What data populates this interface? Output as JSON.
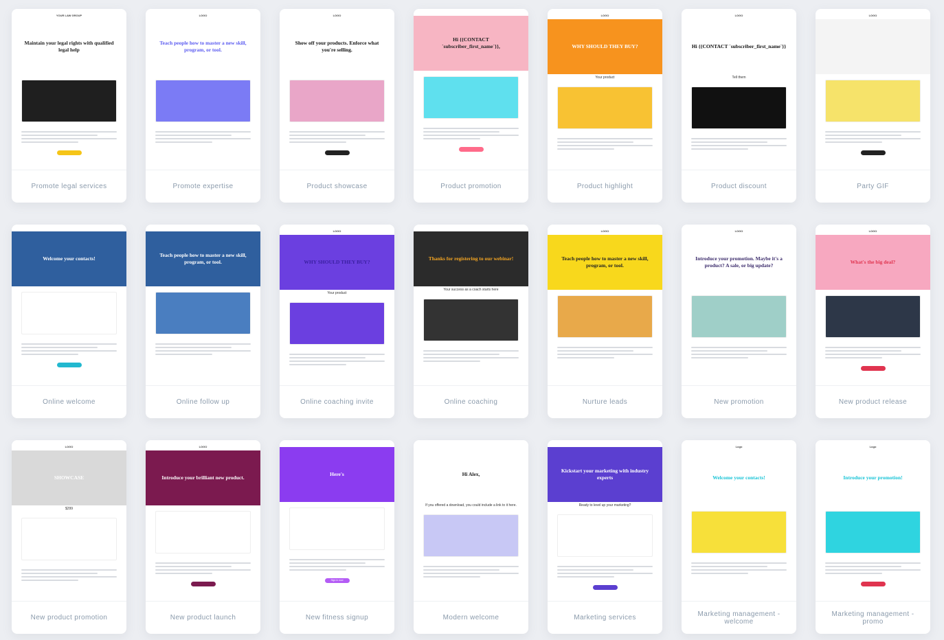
{
  "templates": [
    {
      "label": "Promote legal services",
      "logo": "YOUR LAW GROUP",
      "headline": "Maintain your legal rights with qualified legal help",
      "hero": "#ffffff",
      "text": "#222222",
      "img": "#1f1f1f",
      "btn": "#f5c518"
    },
    {
      "label": "Promote expertise",
      "logo": "LOGO",
      "headline": "Teach people how to master a new skill, program, or tool.",
      "hero": "#ffffff",
      "text": "#5b5bf0",
      "img": "#7b7bf5"
    },
    {
      "label": "Product showcase",
      "logo": "LOGO",
      "headline": "Show off your products. Enforce what you're selling.",
      "hero": "#ffffff",
      "text": "#111111",
      "img": "#e9a6c8",
      "btn": "#222222"
    },
    {
      "label": "Product promotion",
      "logo": "",
      "headline": "Hi {{CONTACT `subscriber_first_name`}},",
      "hero": "#f7b5c3",
      "text": "#222222",
      "img": "#5fe0ee",
      "btn": "#ff6b8a"
    },
    {
      "label": "Product highlight",
      "logo": "LOGO",
      "headline": "WHY SHOULD THEY BUY?",
      "hero": "#f7931e",
      "text": "#ffffff",
      "img": "#f8c233",
      "sub": "Your product"
    },
    {
      "label": "Product discount",
      "logo": "LOGO",
      "headline": "Hi {{CONTACT `subscriber_first_name`}}",
      "hero": "#ffffff",
      "text": "#111111",
      "img": "#111111",
      "sub": "Tell them"
    },
    {
      "label": "Party GIF",
      "logo": "LOGO",
      "headline": "",
      "hero": "#f4f4f4",
      "text": "#222222",
      "img": "#f6e36a",
      "btn": "#222222"
    },
    {
      "label": "Online welcome",
      "logo": "",
      "headline": "Welcome your contacts!",
      "hero": "#2f5f9e",
      "text": "#ffffff",
      "img": "#ffffff",
      "btn": "#22b8cf"
    },
    {
      "label": "Online follow up",
      "logo": "",
      "headline": "Teach people how to master a new skill, program, or tool.",
      "hero": "#2f5f9e",
      "text": "#ffffff",
      "img": "#4a7ec0"
    },
    {
      "label": "Online coaching invite",
      "logo": "LOGO",
      "headline": "WHY SHOULD THEY BUY?",
      "hero": "#6b3fe0",
      "text": "#3a1fa0",
      "img": "#6b3fe0",
      "sub": "Your product"
    },
    {
      "label": "Online coaching",
      "logo": "",
      "headline": "Thanks for registering to our webinar!",
      "hero": "#2b2b2b",
      "text": "#f5a623",
      "img": "#333333",
      "sub": "Your success as a coach starts here"
    },
    {
      "label": "Nurture leads",
      "logo": "LOGO",
      "headline": "Teach people how to master a new skill, program, or tool.",
      "hero": "#f8d81c",
      "text": "#222222",
      "img": "#e8a94a"
    },
    {
      "label": "New promotion",
      "logo": "LOGO",
      "headline": "Introduce your promotion. Maybe it's a product? A sale, or big update?",
      "hero": "#ffffff",
      "text": "#3a2a6a",
      "img": "#9fcfc8"
    },
    {
      "label": "New product release",
      "logo": "LOGO",
      "headline": "What's the big deal?",
      "hero": "#f7a8c0",
      "text": "#e0344f",
      "img": "#2d3748",
      "btn": "#e0344f"
    },
    {
      "label": "New product promotion",
      "logo": "LOGO",
      "headline": "SHOWCASE",
      "hero": "#d9d9d9",
      "text": "#ffffff",
      "img": "#ffffff",
      "sub": "$299"
    },
    {
      "label": "New product launch",
      "logo": "LOGO",
      "headline": "Introduce your brilliant new product.",
      "hero": "#7b1a4f",
      "text": "#ffffff",
      "img": "#ffffff",
      "btn": "#7b1a4f"
    },
    {
      "label": "New fitness signup",
      "logo": "",
      "headline": "Here's",
      "hero": "#8b3cf0",
      "text": "#ffffff",
      "img": "#ffffff",
      "btn": "#b45cf5",
      "button": "Sign in now"
    },
    {
      "label": "Modern welcome",
      "logo": "",
      "headline": "Hi Alex,",
      "hero": "#ffffff",
      "text": "#222222",
      "img": "#c8c8f5",
      "sub": "If you offered a download, you could include a link to it here."
    },
    {
      "label": "Marketing services",
      "logo": "",
      "headline": "Kickstart your marketing with industry experts",
      "hero": "#5b3fd0",
      "text": "#ffffff",
      "img": "#ffffff",
      "sub": "Ready to level up your marketing?",
      "btn": "#5b3fd0"
    },
    {
      "label": "Marketing management - welcome",
      "logo": "Logo",
      "headline": "Welcome your contacts!",
      "hero": "#ffffff",
      "text": "#17c3d6",
      "img": "#f7e03a"
    },
    {
      "label": "Marketing management - promo",
      "logo": "Logo",
      "headline": "Introduce your promotion!",
      "hero": "#ffffff",
      "text": "#17c3d6",
      "img": "#2fd4e0",
      "btn": "#e0344f"
    }
  ]
}
